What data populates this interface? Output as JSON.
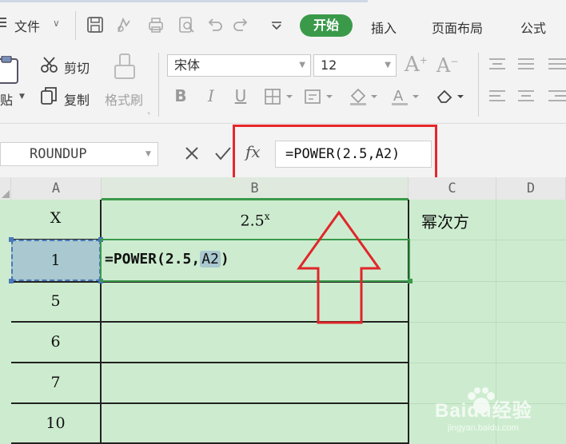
{
  "menu": {
    "file": "文件",
    "tabs": [
      "开始",
      "插入",
      "页面布局",
      "公式"
    ]
  },
  "ribbon": {
    "cut": "剪切",
    "copy": "复制",
    "paste": "贴",
    "format_painter": "格式刷",
    "font_name": "宋体",
    "font_size": "12",
    "bold": "B",
    "italic": "I",
    "underline": "U"
  },
  "formula_bar": {
    "name_box": "ROUNDUP",
    "fx": "fx",
    "formula": "=POWER(2.5,A2)"
  },
  "columns": [
    "A",
    "B",
    "C",
    "D"
  ],
  "cells": {
    "a1": "X",
    "b1": "2.5",
    "b1_sup": "x",
    "c1": "幂次方",
    "a2": "1",
    "b2_prefix": "=POWER(2.5,",
    "b2_ref": "A2",
    "b2_suffix": ")",
    "a3": "5",
    "a4": "6",
    "a5": "7",
    "a6": "10"
  },
  "watermark": {
    "brand": "Baidu经验",
    "url": "jingyan.baidu.com"
  }
}
